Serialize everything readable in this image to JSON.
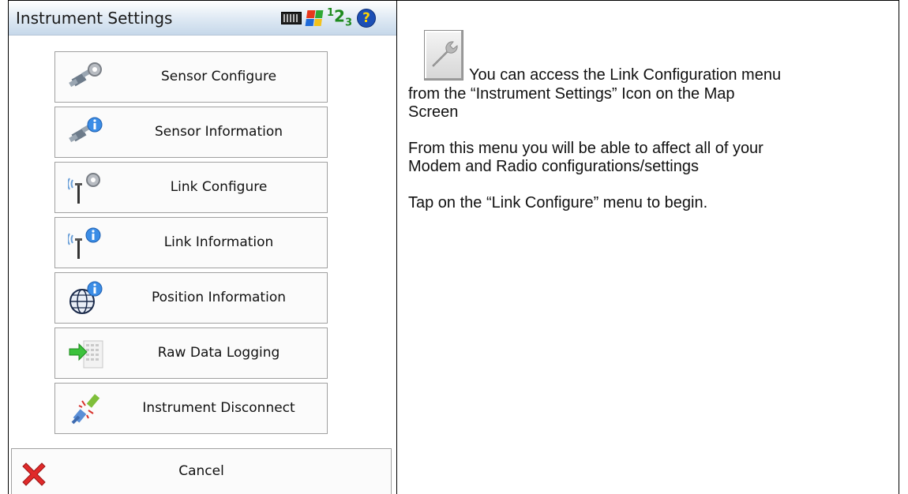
{
  "window": {
    "title": "Instrument Settings"
  },
  "status_icons": [
    "keyboard-icon",
    "windows-flag-icon",
    "input-mode-123-icon",
    "help-icon"
  ],
  "input_mode": {
    "n1": "1",
    "n2": "2",
    "n3": "3"
  },
  "help_glyph": "?",
  "menu": [
    {
      "label": "Sensor Configure",
      "icon": "satellite-gear-icon"
    },
    {
      "label": "Sensor Information",
      "icon": "satellite-info-icon"
    },
    {
      "label": "Link Configure",
      "icon": "antenna-gear-icon"
    },
    {
      "label": "Link Information",
      "icon": "antenna-info-icon"
    },
    {
      "label": "Position Information",
      "icon": "globe-info-icon"
    },
    {
      "label": "Raw Data Logging",
      "icon": "data-log-icon"
    },
    {
      "label": "Instrument Disconnect",
      "icon": "disconnect-plug-icon"
    }
  ],
  "cancel": {
    "label": "Cancel",
    "icon": "red-x-icon"
  },
  "description": {
    "line1": "You can access the Link Configuration menu",
    "line2": "from the “Instrument Settings” Icon  on the Map",
    "line3": "Screen",
    "line4": "From this menu you will be able to affect all of your",
    "line5": "Modem and Radio configurations/settings",
    "line6": "Tap on the “Link Configure” menu to begin."
  },
  "colors": {
    "titlebar_top": "#ffffff",
    "titlebar_bottom": "#c6d8ea",
    "help_blue": "#1c4fb5",
    "cancel_red": "#e02a2a"
  }
}
